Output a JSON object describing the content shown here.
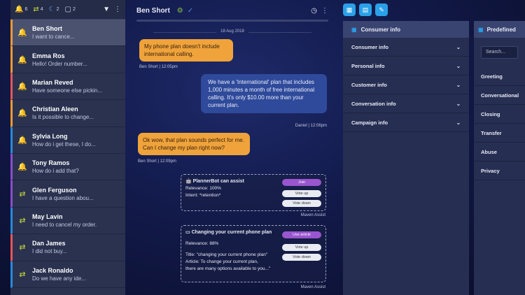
{
  "topbar": {
    "counts": [
      {
        "icon": "bell-icon",
        "glyph": "🔔",
        "value": "6",
        "color": "#e8555a"
      },
      {
        "icon": "transfer-icon",
        "glyph": "⇄",
        "value": "4",
        "color": "#c7d63a"
      },
      {
        "icon": "moon-icon",
        "glyph": "☾",
        "value": "2",
        "color": "#6f9cf0"
      },
      {
        "icon": "chat-icon",
        "glyph": "▢",
        "value": "2",
        "color": "#cfd5ee"
      }
    ]
  },
  "conversations": [
    {
      "name": "Ben Short",
      "preview": "I want to cance...",
      "icon": "bell-icon",
      "glyph": "🔔",
      "color": "#e8555a",
      "bar": "#ef9a34",
      "active": true
    },
    {
      "name": "Emma Ros",
      "preview": "Hello! Order number...",
      "icon": "bell-icon",
      "glyph": "🔔",
      "color": "#e8555a",
      "bar": "#ef9a34"
    },
    {
      "name": "Marian Reved",
      "preview": "Have someone else pickin...",
      "icon": "bell-icon",
      "glyph": "🔔",
      "color": "#e8555a",
      "bar": "#e8555a"
    },
    {
      "name": "Christian Aleen",
      "preview": "Is it possible to change...",
      "icon": "bell-icon",
      "glyph": "🔔",
      "color": "#e8555a",
      "bar": "#ef9a34"
    },
    {
      "name": "Sylvia Long",
      "preview": "How do i get these, I do...",
      "icon": "bell-icon",
      "glyph": "🔔",
      "color": "#e8555a",
      "bar": "#2a8ad8"
    },
    {
      "name": "Tony Ramos",
      "preview": "How do i add that?",
      "icon": "bell-icon",
      "glyph": "🔔",
      "color": "#e8555a",
      "bar": "#8a4ec8"
    },
    {
      "name": "Glen Ferguson",
      "preview": "I have a question abou...",
      "icon": "transfer-icon",
      "glyph": "⇄",
      "color": "#c7d63a",
      "bar": "#8a4ec8"
    },
    {
      "name": "May Lavin",
      "preview": "I need to cancel my order.",
      "icon": "transfer-icon",
      "glyph": "⇄",
      "color": "#c7d63a",
      "bar": "#2a8ad8"
    },
    {
      "name": "Dan James",
      "preview": "I did  not buy...",
      "icon": "transfer-icon",
      "glyph": "⇄",
      "color": "#c7d63a",
      "bar": "#e8555a"
    },
    {
      "name": "Jack Ronaldo",
      "preview": "Do we have any ide...",
      "icon": "transfer-icon",
      "glyph": "⇄",
      "color": "#c7d63a",
      "bar": "#2a8ad8"
    }
  ],
  "chat": {
    "title": "Ben Short",
    "date": "18 Aug 2018",
    "msg1": "My phone plan doesn't include international calling.",
    "meta1": "Ben Short | 12:05pm",
    "msg2": "We have a 'International' plan that includes 1,000 minutes a month of free international calling. It's only $10.00 more than your current plan.",
    "meta2": "Daniel | 12:06pm",
    "msg3": "Ok wow, that plan sounds perfect for me. Can I change my plan right now?",
    "meta3": "Ben Short | 12:09pm",
    "card1": {
      "title": "PlannerBot can assist",
      "relevance": "Relevance: 100%",
      "intent": "Intent: *retention*",
      "btn_primary": "Join",
      "btn_up": "Vote up",
      "btn_down": "Vote down",
      "footer": "Maven Assist"
    },
    "card2": {
      "title": "Changing your current phone plan",
      "relevance": "Relevance: 88%",
      "line1": "Title: \"changing your current phone plan\"",
      "line2": "Article: To change your current plan,",
      "line3": "there are many options available to you...\"",
      "btn_primary": "Use article",
      "btn_up": "Vote up",
      "btn_down": "Vote down",
      "footer": "Maven Assist"
    }
  },
  "consumer_panel": {
    "title": "Consumer info",
    "items": [
      "Consumer info",
      "Personal info",
      "Customer info",
      "Conversation info",
      "Campaign info"
    ]
  },
  "predefined_panel": {
    "title": "Predefined",
    "search_placeholder": "Search...",
    "items": [
      "Greeting",
      "Conversational",
      "Closing",
      "Transfer",
      "Abuse",
      "Privacy"
    ]
  }
}
